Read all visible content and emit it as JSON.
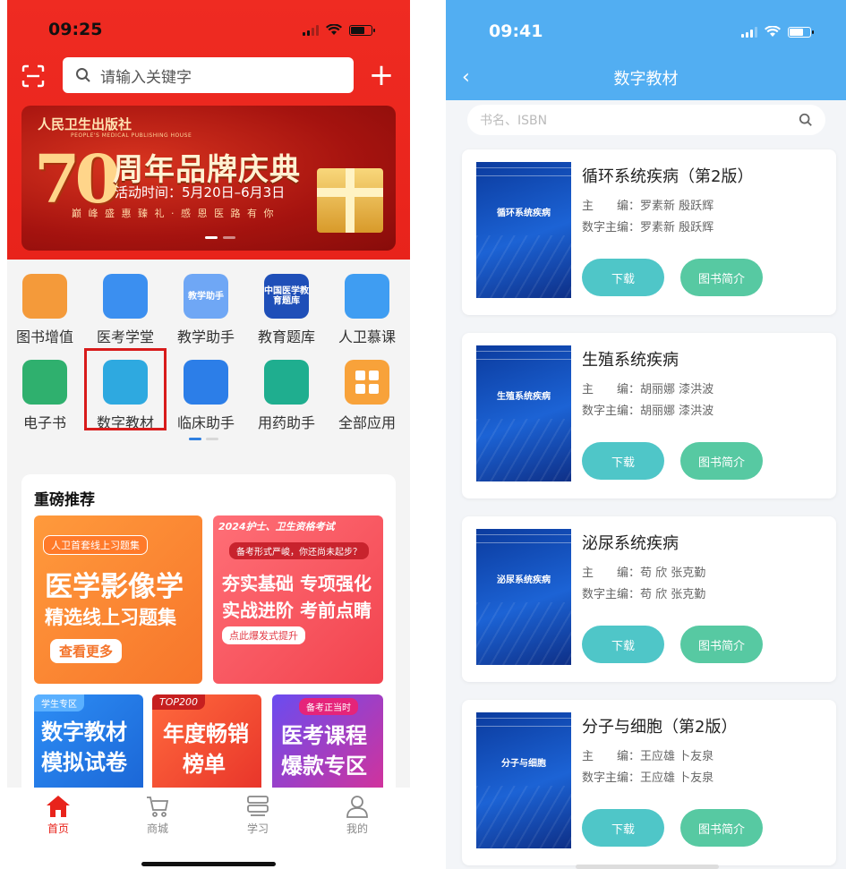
{
  "left": {
    "status": {
      "time": "09:25"
    },
    "search": {
      "placeholder": "请输入关键字"
    },
    "banner": {
      "publisher": "人民卫生出版社",
      "publisher_en": "PEOPLE'S MEDICAL PUBLISHING HOUSE",
      "number": "70",
      "title": "周年品牌庆典",
      "date": "活动时间：5月20日–6月3日",
      "slogan": "巅 峰 盛 惠 臻 礼 · 感 恩 医 路 有 你"
    },
    "apps": [
      {
        "label": "图书增值",
        "icon": "book-value-icon",
        "color": "#f49a3a"
      },
      {
        "label": "医考学堂",
        "icon": "exam-school-icon",
        "color": "#3b8ff0"
      },
      {
        "label": "教学助手",
        "icon": "teaching-assistant-icon",
        "color": "#6fa7f5",
        "icon_text": "教学助手"
      },
      {
        "label": "教育题库",
        "icon": "question-bank-icon",
        "color": "#1f4fb8",
        "icon_text": "中国医学教育题库"
      },
      {
        "label": "人卫慕课",
        "icon": "mooc-icon",
        "color": "#3f9df2"
      },
      {
        "label": "电子书",
        "icon": "ebook-icon",
        "color": "#2fb06e"
      },
      {
        "label": "数字教材",
        "icon": "digital-textbook-icon",
        "color": "#2ea9e0"
      },
      {
        "label": "临床助手",
        "icon": "clinical-assistant-icon",
        "color": "#2c7ee8"
      },
      {
        "label": "用药助手",
        "icon": "medication-assistant-icon",
        "color": "#1fae8f"
      },
      {
        "label": "全部应用",
        "icon": "all-apps-icon",
        "color": "#f8a23a"
      }
    ],
    "recommend": {
      "heading": "重磅推荐",
      "tiles": [
        {
          "tag": "人卫首套线上习题集",
          "line1": "医学影像学",
          "line2": "精选线上习题集",
          "cta": "查看更多"
        },
        {
          "tag": "2024护士、卫生资格考试",
          "sub": "备考形式严峻，你还尚未起步？",
          "line1": "夯实基础 专项强化",
          "line2": "实战进阶 考前点睛",
          "cta": "点此爆发式提升"
        },
        {
          "tag": "学生专区",
          "line1": "数字教材",
          "line2": "模拟试卷"
        },
        {
          "tag": "TOP200",
          "line1": "年度畅销",
          "line2": "榜单"
        },
        {
          "tag": "备考正当时",
          "line1": "医考课程",
          "line2": "爆款专区"
        }
      ]
    },
    "tabs": [
      {
        "label": "首页",
        "icon": "home-icon"
      },
      {
        "label": "商城",
        "icon": "cart-icon"
      },
      {
        "label": "学习",
        "icon": "study-icon"
      },
      {
        "label": "我的",
        "icon": "profile-icon"
      }
    ]
  },
  "right": {
    "status": {
      "time": "09:41"
    },
    "nav_title": "数字教材",
    "search": {
      "placeholder": "书名、ISBN"
    },
    "books": [
      {
        "name": "循环系统疾病（第2版）",
        "editor": "主　　编：罗素新  殷跃辉",
        "digital_editor": "数字主编：罗素新  殷跃辉",
        "cover_title": "循环系统疾病"
      },
      {
        "name": "生殖系统疾病",
        "editor": "主　　编：胡丽娜  漆洪波",
        "digital_editor": "数字主编：胡丽娜  漆洪波",
        "cover_title": "生殖系统疾病"
      },
      {
        "name": "泌尿系统疾病",
        "editor": "主　　编：苟  欣   张克勤",
        "digital_editor": "数字主编：苟  欣   张克勤",
        "cover_title": "泌尿系统疾病"
      },
      {
        "name": "分子与细胞（第2版）",
        "editor": "主　　编：王应雄  卜友泉",
        "digital_editor": "数字主编：王应雄  卜友泉",
        "cover_title": "分子与细胞"
      }
    ],
    "buttons": {
      "download": "下载",
      "intro": "图书简介"
    }
  }
}
